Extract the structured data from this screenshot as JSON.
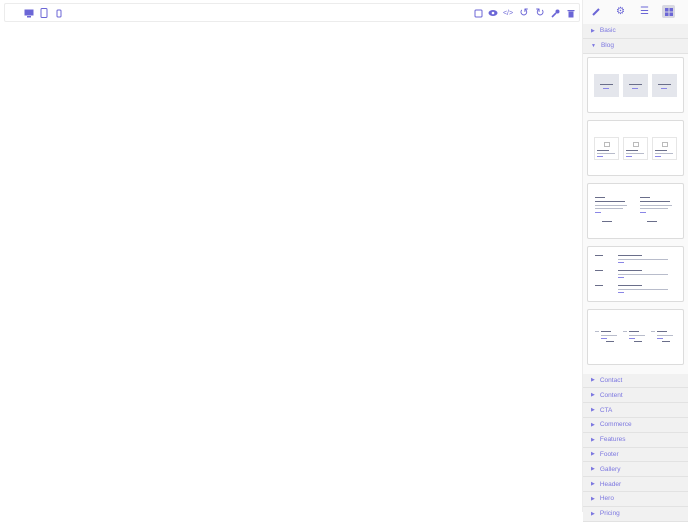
{
  "toolbar": {
    "devices": [
      {
        "icon": "desktop-icon",
        "glyph": "🖵"
      },
      {
        "icon": "tablet-icon",
        "glyph": "▯"
      },
      {
        "icon": "mobile-icon",
        "glyph": "▯"
      }
    ],
    "actions": [
      {
        "icon": "outline-icon",
        "glyph": "□"
      },
      {
        "icon": "eye-icon",
        "glyph": "◉"
      },
      {
        "icon": "code-icon",
        "glyph": "</>"
      },
      {
        "icon": "undo-icon",
        "glyph": "↺"
      },
      {
        "icon": "redo-icon",
        "glyph": "↻"
      },
      {
        "icon": "wrench-icon",
        "glyph": "🔧"
      },
      {
        "icon": "trash-icon",
        "glyph": "🗑"
      }
    ]
  },
  "panel": {
    "tabs": [
      {
        "icon": "brush-icon",
        "glyph": "🖌"
      },
      {
        "icon": "gear-icon",
        "glyph": "⚙"
      },
      {
        "icon": "layers-icon",
        "glyph": "☰"
      },
      {
        "icon": "blocks-icon",
        "glyph": "▦",
        "active": true
      }
    ],
    "categories_top": [
      {
        "label": "Basic",
        "open": false
      },
      {
        "label": "Blog",
        "open": true
      }
    ],
    "categories_bottom": [
      "Contact",
      "Content",
      "CTA",
      "Commerce",
      "Features",
      "Footer",
      "Gallery",
      "Header",
      "Hero",
      "Pricing"
    ]
  },
  "accent": "#6b66d6"
}
